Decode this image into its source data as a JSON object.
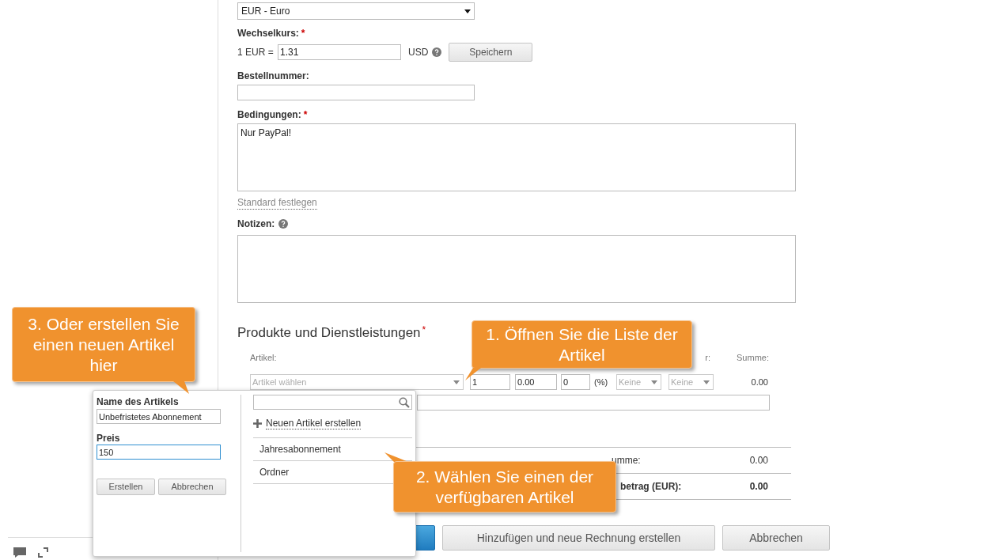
{
  "currency_select": {
    "value": "EUR - Euro"
  },
  "exchange_rate": {
    "label": "Wechselkurs:",
    "required_mark": "*",
    "prefix": "1 EUR =",
    "value": "1.31",
    "unit": "USD",
    "button": "Speichern"
  },
  "order_number": {
    "label": "Bestellnummer:"
  },
  "terms": {
    "label": "Bedingungen:",
    "required_mark": "*",
    "value": "Nur PayPal!",
    "link": "Standard festlegen"
  },
  "notes": {
    "label": "Notizen:"
  },
  "products": {
    "title": "Produkte und Dienstleistungen",
    "required_mark": "*",
    "columns": [
      "Artikel:",
      "r:",
      "Summe:"
    ],
    "row": {
      "item_placeholder": "Artikel wählen",
      "quantity": "1",
      "price": "0.00",
      "discount": "0",
      "discount_unit": "(%)",
      "tax_1": "Keine",
      "tax_2": "Keine",
      "total": "0.00"
    }
  },
  "totals": [
    {
      "label": "umme:",
      "value": "0.00",
      "bold": false
    },
    {
      "label": "betrag (EUR):",
      "value": "0.00",
      "bold": true
    }
  ],
  "buttons": [
    {
      "kind": "primary"
    },
    {
      "kind": "secondary",
      "label": "Hinzufügen und neue Rechnung erstellen"
    },
    {
      "kind": "secondary",
      "label": "Abbrechen"
    }
  ],
  "popup": {
    "name_label": "Name des Artikels",
    "name_value": "Unbefristetes Abonnement",
    "price_label": "Preis",
    "price_value": "150",
    "create_button": "Erstellen",
    "cancel_button": "Abbrechen",
    "new_item_link": "Neuen Artikel erstellen",
    "items": [
      "Jahresabonnement",
      "Ordner"
    ]
  },
  "callouts": [
    {
      "text": "1. Öffnen Sie die Liste der Artikel"
    },
    {
      "text": "2. Wählen Sie einen der verfügbaren Artikel"
    },
    {
      "text": "3. Oder erstellen Sie einen neuen Artikel hier"
    }
  ]
}
